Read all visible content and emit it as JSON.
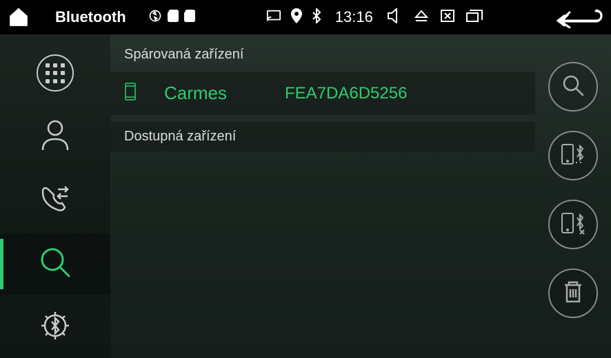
{
  "statusbar": {
    "title": "Bluetooth",
    "time": "13:16"
  },
  "sections": {
    "paired_label": "Spárovaná zařízení",
    "available_label": "Dostupná zařízení"
  },
  "paired_device": {
    "name": "Carmes",
    "mac": "FEA7DA6D5256"
  },
  "colors": {
    "accent": "#2ecc71"
  }
}
